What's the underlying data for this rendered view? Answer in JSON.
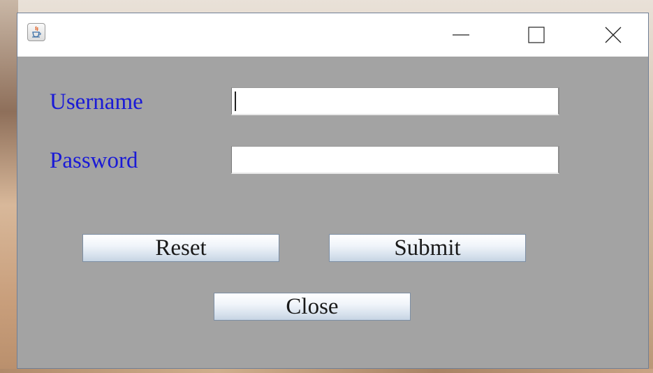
{
  "window": {
    "title": "",
    "app_icon": "java-icon",
    "controls": {
      "minimize_icon": "minimize-icon",
      "maximize_icon": "maximize-icon",
      "close_icon": "close-icon"
    }
  },
  "form": {
    "username_label": "Username",
    "username_value": "",
    "password_label": "Password",
    "password_value": ""
  },
  "buttons": {
    "reset_label": "Reset",
    "submit_label": "Submit",
    "close_label": "Close"
  },
  "colors": {
    "label_text": "#1a1ad6",
    "panel_background": "#a3a3a3",
    "titlebar_background": "#ffffff"
  }
}
